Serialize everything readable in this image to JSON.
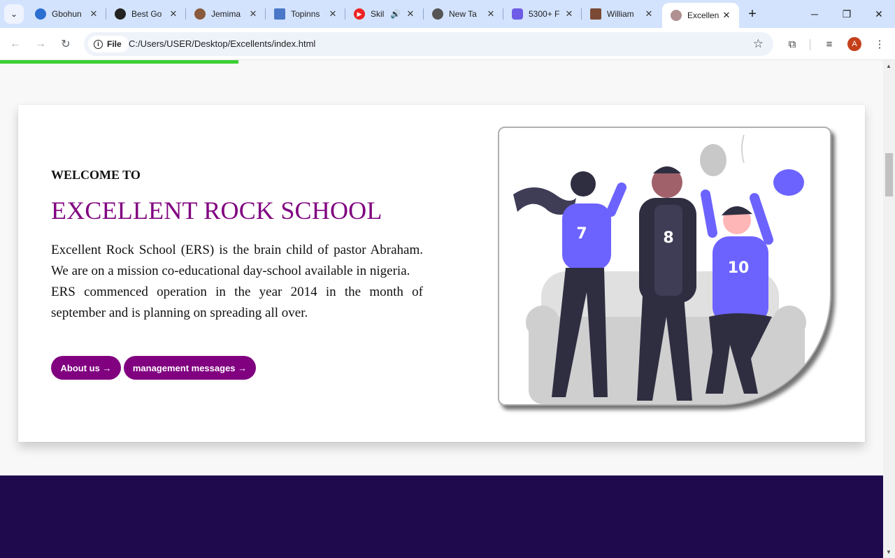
{
  "browser": {
    "tabs": [
      {
        "title": "Gbohun",
        "favicon_color": "#2b6fd1"
      },
      {
        "title": "Best Go",
        "favicon_color": "#222222"
      },
      {
        "title": "Jemima",
        "favicon_color": "#8a5a3c"
      },
      {
        "title": "Topinns",
        "favicon_color": "#4a78c8"
      },
      {
        "title": "Skil",
        "favicon_color": "#e22"
      },
      {
        "title": "New Ta",
        "favicon_color": "#555555"
      },
      {
        "title": "5300+ F",
        "favicon_color": "#6e5ce6"
      },
      {
        "title": "William",
        "favicon_color": "#7a4a35"
      },
      {
        "title": "Excellen",
        "favicon_color": "#b09090"
      }
    ],
    "active_tab_index": 8,
    "address_chip": "File",
    "url": "C:/Users/USER/Desktop/Excellents/index.html",
    "profile_initial": "A",
    "page_load_progress": 0.27
  },
  "page": {
    "welcome": "WELCOME TO",
    "headline": "EXCELLENT ROCK SCHOOL",
    "paragraph_1": "Excellent Rock School (ERS) is the brain child of pastor Abraham. We are on a mission co-educational day-school available in nigeria.",
    "paragraph_2": "ERS commenced operation in the year 2014 in the month of september and is planning on spreading all over.",
    "buttons": {
      "about": "About us →",
      "management": "management messages →"
    },
    "hero": {
      "jersey_numbers": [
        "7",
        "8",
        "10"
      ]
    },
    "colors": {
      "accent": "#800080",
      "footer": "#1f0a4d",
      "figure": "#6c63ff"
    }
  }
}
